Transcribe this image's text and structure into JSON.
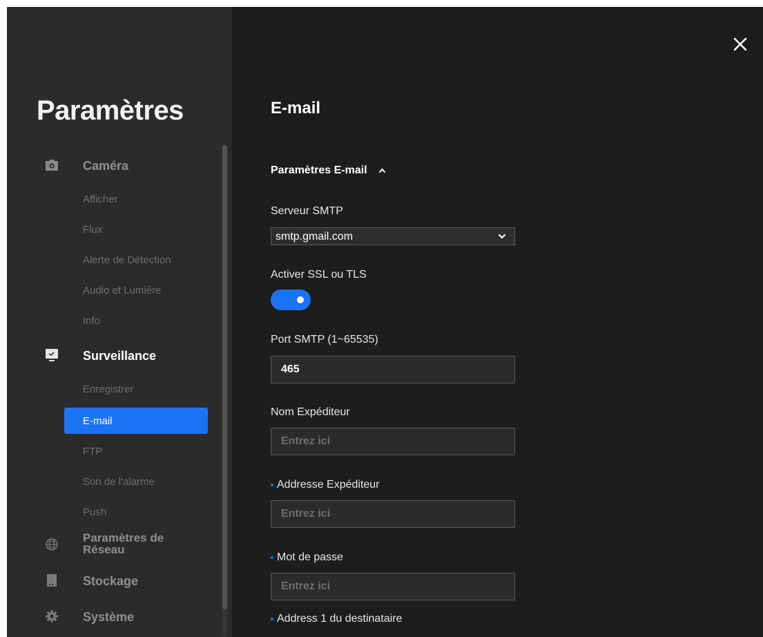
{
  "sidebar": {
    "title": "Paramètres",
    "groups": [
      {
        "label": "Caméra",
        "icon": "camera-icon",
        "items": [
          "Afficher",
          "Flux",
          "Alerte de Détection",
          "Audio et Lumière",
          "Info"
        ]
      },
      {
        "label": "Surveillance",
        "icon": "monitor-icon",
        "items": [
          "Enregistrer",
          "E-mail",
          "FTP",
          "Son de l'alarme",
          "Push"
        ]
      },
      {
        "label_line1": "Paramètres de",
        "label_line2": "Réseau",
        "icon": "globe-icon"
      },
      {
        "label": "Stockage",
        "icon": "storage-icon"
      },
      {
        "label": "Système",
        "icon": "gear-icon"
      }
    ],
    "selected_item": "E-mail",
    "accent_color": "#1a73f5"
  },
  "main": {
    "close_icon": "close-icon",
    "title": "E-mail",
    "section": {
      "label": "Paramètres E-mail",
      "icon": "chevron-up-icon",
      "expanded": true
    },
    "smtp_server": {
      "label": "Serveur SMTP",
      "value": "smtp.gmail.com"
    },
    "ssl_tls": {
      "label": "Activer SSL ou TLS",
      "enabled": true
    },
    "smtp_port": {
      "label": "Port SMTP (1~65535)",
      "value": "465"
    },
    "sender_name": {
      "label": "Nom Expéditeur",
      "placeholder": "Entrez ici",
      "value": ""
    },
    "sender_address": {
      "label": "Addresse Expéditeur",
      "placeholder": "Entrez ici",
      "value": ""
    },
    "password": {
      "label": "Mot de passe",
      "placeholder": "Entrez ici",
      "value": ""
    },
    "recipient_1": {
      "label": "Address 1 du destinataire"
    }
  }
}
